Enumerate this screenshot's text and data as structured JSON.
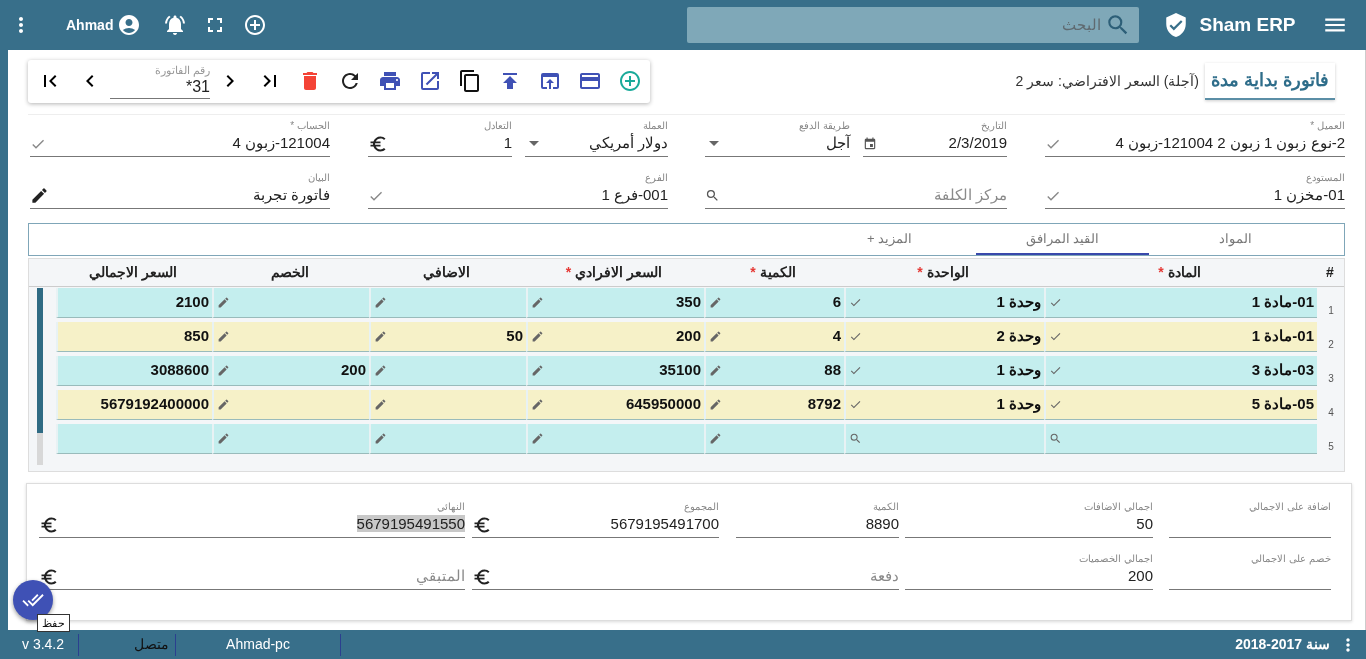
{
  "topbar": {
    "user": "Ahmad",
    "search_placeholder": "البحث",
    "app_name": "Sham ERP"
  },
  "toolbar": {
    "number_label": "رقم الفاتورة",
    "number_value": "*31"
  },
  "header": {
    "title": "فاتورة بداية مدة",
    "subtitle": "(آجلة) السعر الافتراضي: سعر 2"
  },
  "form_rows": [
    [
      {
        "label": "العميل *",
        "value": "2-نوع زبون 1 زبون 2  121004-زبون 4",
        "kind": "check"
      },
      {
        "label": "التاريخ",
        "value": "2/3/2019",
        "kind": "date"
      },
      {
        "label": "طريقة الدفع",
        "value": "آجل",
        "kind": "dropdown"
      },
      {
        "label": "العملة",
        "value": "دولار أمريكي",
        "kind": "dropdown"
      },
      {
        "label": "التعادل",
        "value": "1",
        "kind": "currency"
      },
      {
        "label": "الحساب *",
        "value": "121004-زبون 4",
        "kind": "check"
      }
    ],
    [
      {
        "label": "المستودع",
        "value": "01-مخزن 1",
        "kind": "check"
      },
      {
        "placeholder": "مركز الكلفة",
        "kind": "search"
      },
      {
        "label": "الفرع",
        "value": "001-فرع 1",
        "kind": "check"
      },
      {
        "label": "البيان",
        "value": "فاتورة تجربة",
        "kind": "edit"
      }
    ]
  ],
  "tabs": [
    {
      "label": "المواد",
      "selected": false
    },
    {
      "label": "القيد المرافق",
      "selected": true
    },
    {
      "label": "المزيد +",
      "selected": false
    }
  ],
  "table": {
    "columns": [
      {
        "label": "#"
      },
      {
        "label": "المادة",
        "mark": "*"
      },
      {
        "label": "الواحدة",
        "mark": "*"
      },
      {
        "label": "الكمية",
        "mark": "*"
      },
      {
        "label": "السعر الافرادي",
        "mark": "*"
      },
      {
        "label": "الاضافي"
      },
      {
        "label": "الخصم"
      },
      {
        "label": "السعر الاجمالي"
      }
    ],
    "rows": [
      {
        "number": "1",
        "color": "#c4eeee",
        "cells": [
          {
            "kind": "check",
            "value": "01-مادة 1"
          },
          {
            "kind": "check",
            "value": "وحدة 1"
          },
          {
            "kind": "edit",
            "value": "6"
          },
          {
            "kind": "edit",
            "value": "350"
          },
          {
            "kind": "edit"
          },
          {
            "kind": "edit"
          },
          {
            "kind": "plain",
            "value": "2100"
          }
        ]
      },
      {
        "number": "2",
        "color": "#f6f1c8",
        "cells": [
          {
            "kind": "check",
            "value": "01-مادة 1"
          },
          {
            "kind": "check",
            "value": "وحدة 2"
          },
          {
            "kind": "edit",
            "value": "4"
          },
          {
            "kind": "edit",
            "value": "200"
          },
          {
            "kind": "edit",
            "value": "50"
          },
          {
            "kind": "edit"
          },
          {
            "kind": "plain",
            "value": "850"
          }
        ]
      },
      {
        "number": "3",
        "color": "#c4eeee",
        "cells": [
          {
            "kind": "check",
            "value": "03-مادة 3"
          },
          {
            "kind": "check",
            "value": "وحدة 1"
          },
          {
            "kind": "edit",
            "value": "88"
          },
          {
            "kind": "edit",
            "value": "35100"
          },
          {
            "kind": "edit"
          },
          {
            "kind": "edit",
            "value": "200"
          },
          {
            "kind": "plain",
            "value": "3088600"
          }
        ]
      },
      {
        "number": "4",
        "color": "#f6f1c8",
        "cells": [
          {
            "kind": "check",
            "value": "05-مادة 5"
          },
          {
            "kind": "check",
            "value": "وحدة 1"
          },
          {
            "kind": "edit",
            "value": "8792"
          },
          {
            "kind": "edit",
            "value": "645950000"
          },
          {
            "kind": "edit"
          },
          {
            "kind": "edit"
          },
          {
            "kind": "plain",
            "value": "5679192400000"
          }
        ]
      },
      {
        "number": "5",
        "color": "#c4eeee",
        "cells": [
          {
            "kind": "search"
          },
          {
            "kind": "search"
          },
          {
            "kind": "edit"
          },
          {
            "kind": "edit"
          },
          {
            "kind": "edit"
          },
          {
            "kind": "edit"
          },
          {
            "kind": "plain"
          }
        ]
      }
    ]
  },
  "totals_rows": [
    [
      {
        "label": "اضافة على الاجمالي",
        "kind": "plain"
      },
      {
        "label": "اجمالي الاضافات",
        "value": "50",
        "kind": "plain"
      },
      {
        "label": "الكمية",
        "value": "8890",
        "kind": "plain"
      },
      {
        "label": "المجموع",
        "value": "5679195491700",
        "kind": "currency"
      },
      {
        "label": "النهائي",
        "value": "5679195491550",
        "kind": "currency",
        "highlighted": true
      }
    ],
    [
      {
        "label": "خصم على الاجمالي",
        "kind": "plain"
      },
      {
        "label": "اجمالي الخصميات",
        "value": "200",
        "kind": "plain"
      },
      {
        "placeholder": "دفعة",
        "kind": "currency"
      },
      {
        "placeholder": "المتبقي",
        "kind": "currency"
      }
    ]
  ],
  "save_button": {
    "tooltip": "حفظ"
  },
  "status_bar": {
    "version": "v 3.4.2",
    "connection": "متصل",
    "computer": "Ahmad-pc",
    "year": "سنة 2017-2018"
  }
}
